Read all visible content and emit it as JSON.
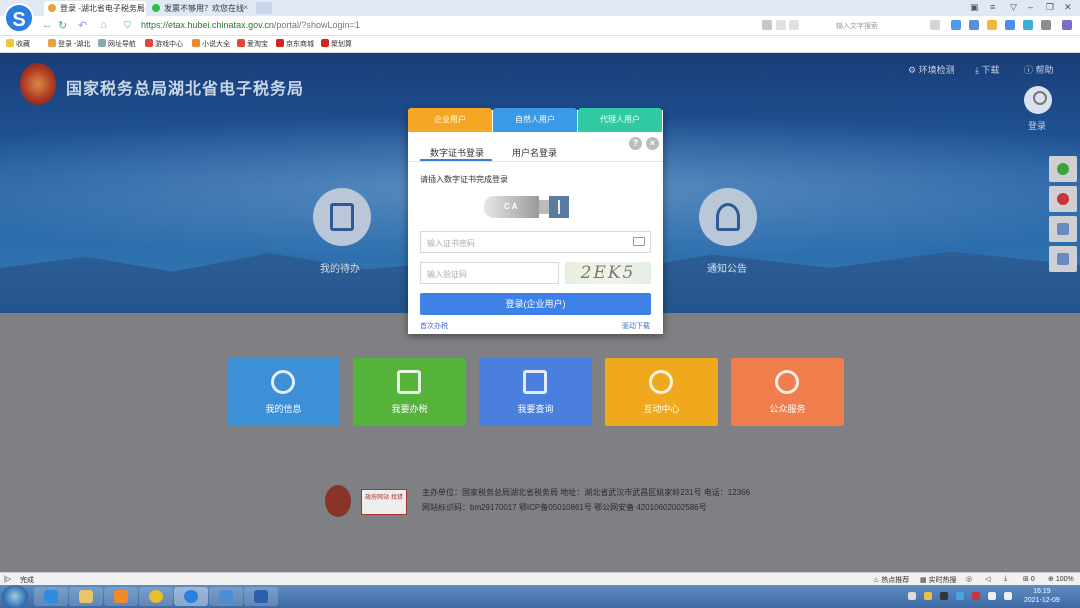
{
  "browser": {
    "tabs": [
      {
        "label": "登录 -湖北省电子税务局",
        "close": "×"
      },
      {
        "label": "发票不够用？欢您在线",
        "close": "×"
      }
    ],
    "url_host": "https://etax.hubei.chinatax.gov.cn",
    "url_path": "/portal/?showLogin=1",
    "search_placeholder": "输入文字搜索",
    "bookmarks": [
      "收藏",
      "登录 -湖北",
      "网址导航",
      "游戏中心",
      "小说大全",
      "爱淘宝",
      "京东商城",
      "聚划算"
    ]
  },
  "site": {
    "title": "国家税务总局湖北省电子税务局",
    "toplinks": [
      "环境检测",
      "下载",
      "帮助"
    ],
    "login_label": "登录",
    "circle_left_label": "我的待办",
    "circle_right_label": "通知公告",
    "tiles": [
      {
        "label": "我的信息",
        "color": "#3d8fd6"
      },
      {
        "label": "我要办税",
        "color": "#55b33b"
      },
      {
        "label": "我要查询",
        "color": "#4a7fde"
      },
      {
        "label": "互动中心",
        "color": "#f0a81d"
      },
      {
        "label": "公众服务",
        "color": "#f07d4c"
      }
    ],
    "footer_logo2": "政府网站 找错",
    "footer_line1": "主办单位：国家税务总局湖北省税务局   地址：湖北省武汉市武昌区姚家岭231号  电话：12366",
    "footer_line2": "网站标识码：bm29170017    鄂ICP备05010861号   鄂公网安备 42010602002586号"
  },
  "dialog": {
    "tabs": [
      {
        "label": "企业用户",
        "color": "#f5a623"
      },
      {
        "label": "自然人用户",
        "color": "#3a9ae8"
      },
      {
        "label": "代理人用户",
        "color": "#2fc9a2"
      }
    ],
    "subtabs": [
      "数字证书登录",
      "用户名登录"
    ],
    "hint": "请插入数字证书完成登录",
    "usb_label": "CA",
    "cert_password_placeholder": "输入证书密码",
    "captcha_placeholder": "输入验证码",
    "captcha_text": "2EK5",
    "login_button": "登录(企业用户)",
    "link_first": "首次办税",
    "link_driver": "驱动下载"
  },
  "statusbar": {
    "left": "完成",
    "hot_recommend": "热点推荐",
    "live_hot": "实时热搜",
    "zoom_counter": "0",
    "zoom": "100%"
  },
  "taskbar": {
    "time": "16:19",
    "date": "2021-12-09"
  }
}
